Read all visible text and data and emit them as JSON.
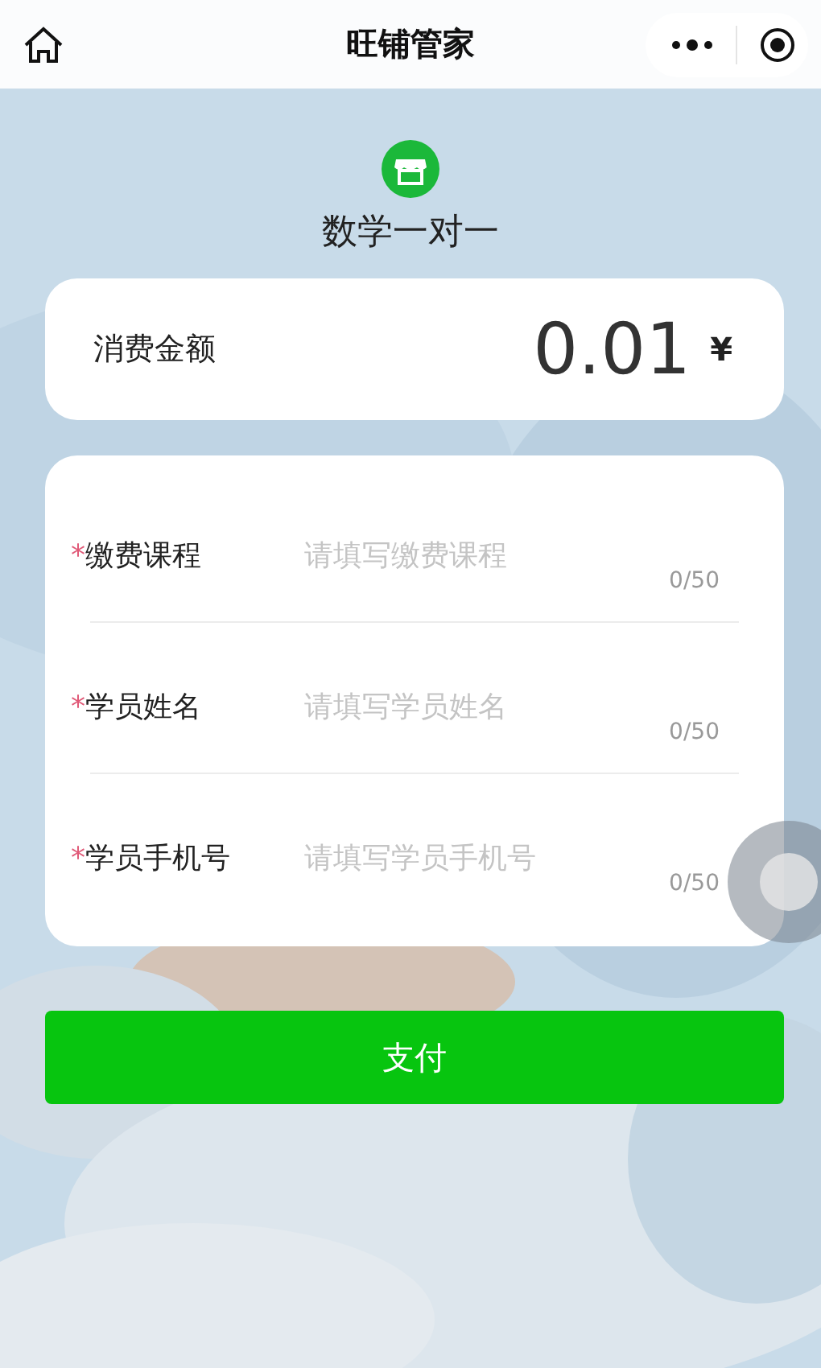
{
  "nav_bar": {
    "title": "旺铺管家"
  },
  "shop": {
    "name": "数学一对一"
  },
  "amount": {
    "label": "消费金额",
    "value": "0.01",
    "currency": "¥"
  },
  "fields": [
    {
      "label": "缴费课程",
      "required_mark": "*",
      "placeholder": "请填写缴费课程",
      "counter": "0/50"
    },
    {
      "label": "学员姓名",
      "required_mark": "*",
      "placeholder": "请填写学员姓名",
      "counter": "0/50"
    },
    {
      "label": "学员手机号",
      "required_mark": "*",
      "placeholder": "请填写学员手机号",
      "counter": "0/50"
    }
  ],
  "pay_button": "支付"
}
